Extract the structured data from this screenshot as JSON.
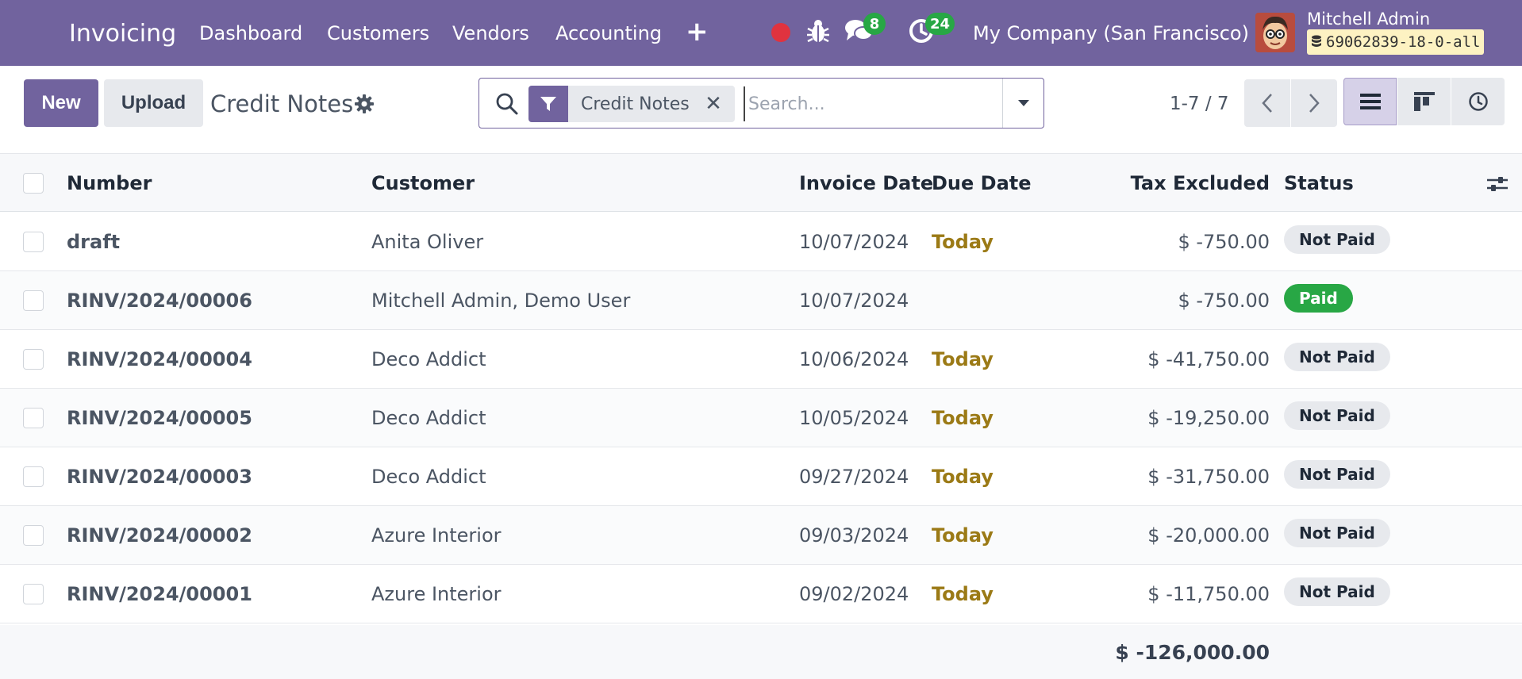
{
  "navbar": {
    "app_name": "Invoicing",
    "menu": [
      "Dashboard",
      "Customers",
      "Vendors",
      "Accounting"
    ],
    "messages_count": "8",
    "activities_count": "24",
    "company": "My Company (San Francisco)",
    "user_name": "Mitchell Admin",
    "db_name": "69062839-18-0-all"
  },
  "control": {
    "new_label": "New",
    "upload_label": "Upload",
    "title": "Credit Notes",
    "facet_label": "Credit Notes",
    "search_placeholder": "Search...",
    "pager": "1-7 / 7"
  },
  "table": {
    "headers": {
      "number": "Number",
      "customer": "Customer",
      "invoice_date": "Invoice Date",
      "due_date": "Due Date",
      "tax_excluded": "Tax Excluded",
      "status": "Status"
    },
    "rows": [
      {
        "number": "draft",
        "customer": "Anita Oliver",
        "invoice_date": "10/07/2024",
        "due_date": "Today",
        "tax_excluded": "$ -750.00",
        "status": "Not Paid"
      },
      {
        "number": "RINV/2024/00006",
        "customer": "Mitchell Admin, Demo User",
        "invoice_date": "10/07/2024",
        "due_date": "",
        "tax_excluded": "$ -750.00",
        "status": "Paid"
      },
      {
        "number": "RINV/2024/00004",
        "customer": "Deco Addict",
        "invoice_date": "10/06/2024",
        "due_date": "Today",
        "tax_excluded": "$ -41,750.00",
        "status": "Not Paid"
      },
      {
        "number": "RINV/2024/00005",
        "customer": "Deco Addict",
        "invoice_date": "10/05/2024",
        "due_date": "Today",
        "tax_excluded": "$ -19,250.00",
        "status": "Not Paid"
      },
      {
        "number": "RINV/2024/00003",
        "customer": "Deco Addict",
        "invoice_date": "09/27/2024",
        "due_date": "Today",
        "tax_excluded": "$ -31,750.00",
        "status": "Not Paid"
      },
      {
        "number": "RINV/2024/00002",
        "customer": "Azure Interior",
        "invoice_date": "09/03/2024",
        "due_date": "Today",
        "tax_excluded": "$ -20,000.00",
        "status": "Not Paid"
      },
      {
        "number": "RINV/2024/00001",
        "customer": "Azure Interior",
        "invoice_date": "09/02/2024",
        "due_date": "Today",
        "tax_excluded": "$ -11,750.00",
        "status": "Not Paid"
      }
    ],
    "total": "$ -126,000.00"
  },
  "icons": {
    "apps": "apps-grid-icon",
    "plus": "plus-icon",
    "record": "record-dot-icon",
    "bug": "bug-icon",
    "chat": "chat-icon",
    "activity": "activity-clock-icon",
    "database": "database-icon",
    "gear": "gear-icon",
    "search": "search-icon",
    "filter": "filter-icon",
    "close": "close-icon",
    "caret": "caret-down-icon",
    "prev": "chevron-left-icon",
    "next": "chevron-right-icon",
    "list_view": "list-view-icon",
    "kanban_view": "kanban-view-icon",
    "activity_view": "activity-view-icon",
    "optional_columns": "sliders-icon"
  },
  "colors": {
    "brand": "#71639e",
    "paid": "#28a745",
    "today": "#9b7a16",
    "record": "#e0333f"
  }
}
